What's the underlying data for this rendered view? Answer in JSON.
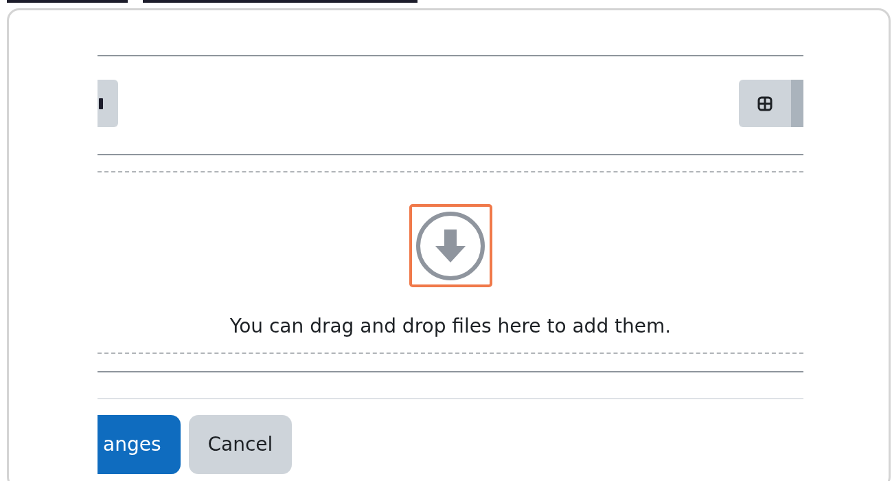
{
  "file_picker": {
    "drop_zone": {
      "message": "You can drag and drop files here to add them.",
      "highlighted": true
    }
  },
  "buttons": [
    {
      "label": "anges",
      "kind": "primary"
    },
    {
      "label": "Cancel",
      "kind": "secondary"
    }
  ]
}
